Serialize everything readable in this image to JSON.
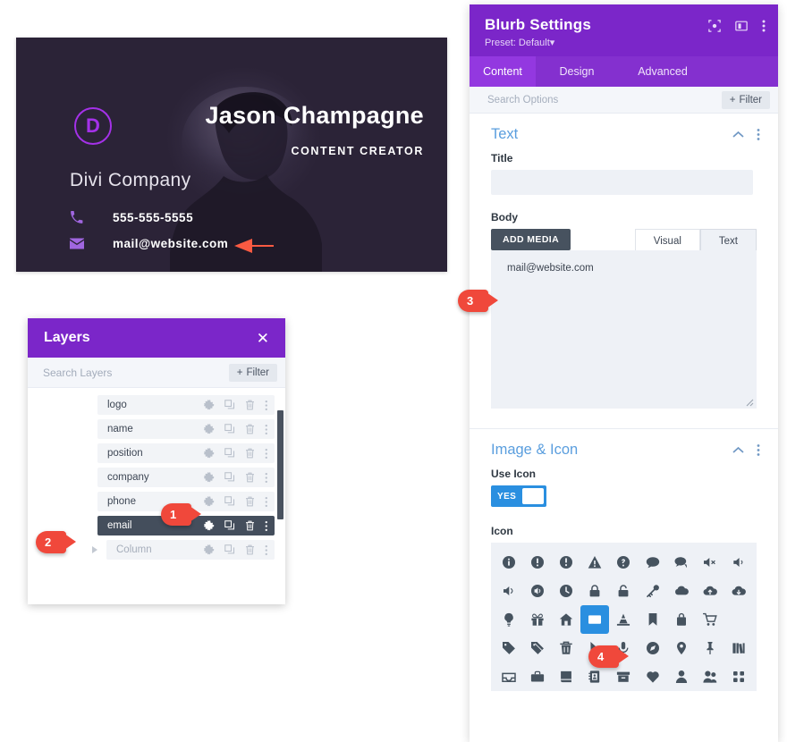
{
  "card": {
    "logo_letter": "D",
    "name": "Jason Champagne",
    "role": "CONTENT CREATOR",
    "company": "Divi Company",
    "phone": "555-555-5555",
    "email": "mail@website.com",
    "bg_color": "#2b2337",
    "accent_color": "#a431e8"
  },
  "layers_panel": {
    "title": "Layers",
    "close_label": "✕",
    "search_placeholder": "Search Layers",
    "filter_label": "Filter",
    "filter_plus": "+",
    "rows": [
      {
        "label": "logo",
        "selected": false,
        "child": false
      },
      {
        "label": "name",
        "selected": false,
        "child": false
      },
      {
        "label": "position",
        "selected": false,
        "child": false
      },
      {
        "label": "company",
        "selected": false,
        "child": false
      },
      {
        "label": "phone",
        "selected": false,
        "child": false
      },
      {
        "label": "email",
        "selected": true,
        "child": false
      },
      {
        "label": "Column",
        "selected": false,
        "child": true
      }
    ],
    "row_actions": [
      "settings-gear",
      "duplicate",
      "delete",
      "more-options"
    ],
    "header_color": "#7b26c9"
  },
  "settings_panel": {
    "title": "Blurb Settings",
    "preset": "Preset: Default",
    "preset_caret": "▾",
    "header_icons": [
      "target-icon",
      "layout-icon",
      "more-vertical-icon"
    ],
    "tabs": [
      {
        "label": "Content",
        "active": true
      },
      {
        "label": "Design",
        "active": false
      },
      {
        "label": "Advanced",
        "active": false
      }
    ],
    "search_placeholder": "Search Options",
    "filter_label": "Filter",
    "filter_plus": "+",
    "sections": [
      {
        "name": "Text",
        "collapse_icon": "chevron-up-icon",
        "more_icon": "more-vertical-icon",
        "title_field": {
          "label": "Title",
          "value": ""
        },
        "body_field": {
          "label": "Body",
          "add_media_label": "ADD MEDIA",
          "editor_tabs": [
            {
              "label": "Visual",
              "active": false
            },
            {
              "label": "Text",
              "active": true
            }
          ],
          "value": "mail@website.com"
        }
      },
      {
        "name": "Image & Icon",
        "collapse_icon": "chevron-up-icon",
        "more_icon": "more-vertical-icon",
        "use_icon": {
          "label": "Use Icon",
          "toggle_value": "YES",
          "enabled": true
        },
        "icon_picker": {
          "label": "Icon",
          "selected_index": 21,
          "selected_icon": "envelope-icon"
        }
      }
    ],
    "header_color": "#7b26c9",
    "tab_bar_color": "#8430cf",
    "section_title_color": "#5a9ede",
    "toggle_on_color": "#2a8fe0"
  },
  "icon_grid": {
    "rows": [
      [
        "info-circle-icon",
        "exclamation-circle-icon",
        "exclamation-circle-alt-icon",
        "warning-triangle-icon",
        "question-circle-icon",
        "speech-bubble-icon",
        "speech-bubbles-icon",
        "volume-mute-icon",
        "volume-low-icon"
      ],
      [
        "volume-medium-icon",
        "volume-high-icon",
        "clock-icon",
        "lock-closed-icon",
        "lock-open-icon",
        "key-icon",
        "cloud-icon",
        "cloud-upload-icon",
        "cloud-download-icon"
      ],
      [
        "lightbulb-icon",
        "gift-icon",
        "house-icon",
        "envelope-icon",
        "traffic-cone-icon",
        "bookmark-icon",
        "bag-icon",
        "shopping-cart-icon",
        "spacer-icon"
      ],
      [
        "tag-icon",
        "tag-alt-icon",
        "trash-icon",
        "cursor-arrow-icon",
        "microphone-icon",
        "compass-icon",
        "map-pin-icon",
        "pushpin-icon",
        "books-icon"
      ],
      [
        "inbox-icon",
        "briefcase-icon",
        "book-icon",
        "address-book-icon",
        "archive-box-icon",
        "heart-icon",
        "user-icon",
        "users-icon",
        "grid-icon"
      ]
    ]
  },
  "callouts": [
    {
      "id": "1",
      "number": "1"
    },
    {
      "id": "2",
      "number": "2"
    },
    {
      "id": "3",
      "number": "3"
    },
    {
      "id": "4",
      "number": "4"
    }
  ]
}
